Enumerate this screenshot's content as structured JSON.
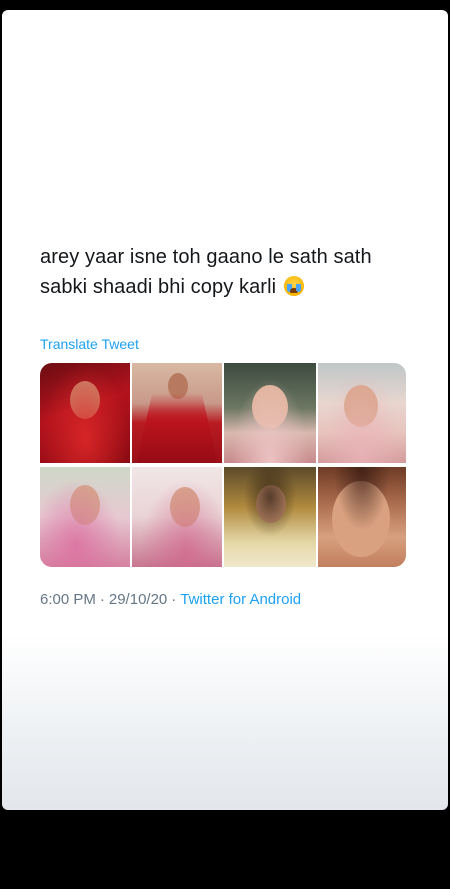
{
  "tweet": {
    "text_line1": "arey yaar isne toh gaano le sath sath",
    "text_line2": "sabki shaadi bhi copy karli",
    "emoji_icon": "loudly-crying-face-icon",
    "translate_label": "Translate Tweet",
    "time": "6:00 PM",
    "date": "29/10/20",
    "separator": "·",
    "source": "Twitter for Android"
  },
  "colors": {
    "link": "#1da1f2",
    "text": "#14171a",
    "meta": "#657786"
  },
  "media": {
    "photos": [
      {
        "name": "bride-red-veil-photo-1"
      },
      {
        "name": "bride-red-veil-photo-2"
      },
      {
        "name": "bride-pastel-veil-photo-3"
      },
      {
        "name": "bride-pastel-veil-photo-4"
      },
      {
        "name": "bride-pink-dupatta-photo-5"
      },
      {
        "name": "bride-pink-dupatta-photo-6"
      },
      {
        "name": "bride-gold-veil-photo-7"
      },
      {
        "name": "bride-closeup-photo-8"
      }
    ]
  }
}
